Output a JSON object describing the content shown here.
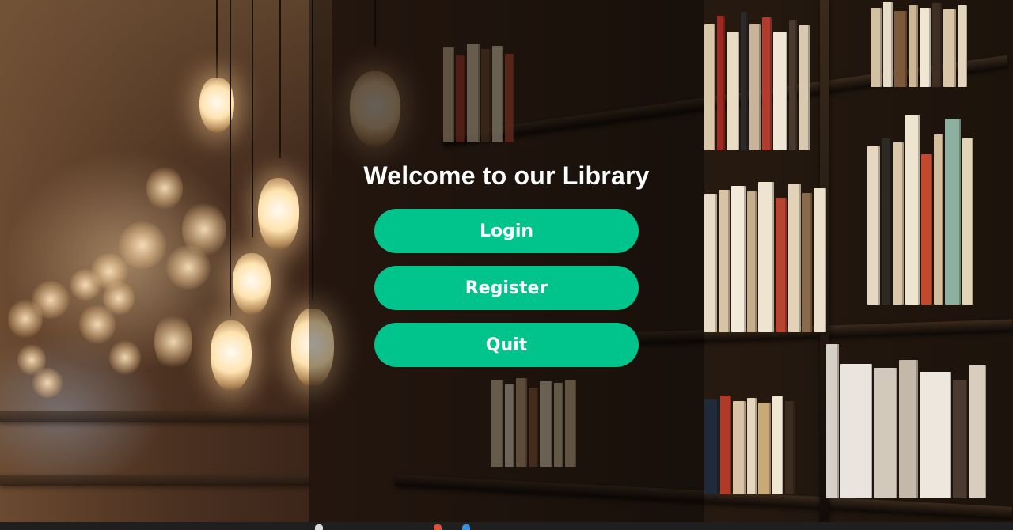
{
  "window": {
    "title": "Welcome to our Library"
  },
  "menu": {
    "login_label": "Login",
    "register_label": "Register",
    "quit_label": "Quit"
  },
  "colors": {
    "button_bg": "#00c48c",
    "button_text": "#ffffff",
    "title_text": "#ffffff"
  },
  "icons": {
    "background": "library-bookshelf-background-image"
  }
}
